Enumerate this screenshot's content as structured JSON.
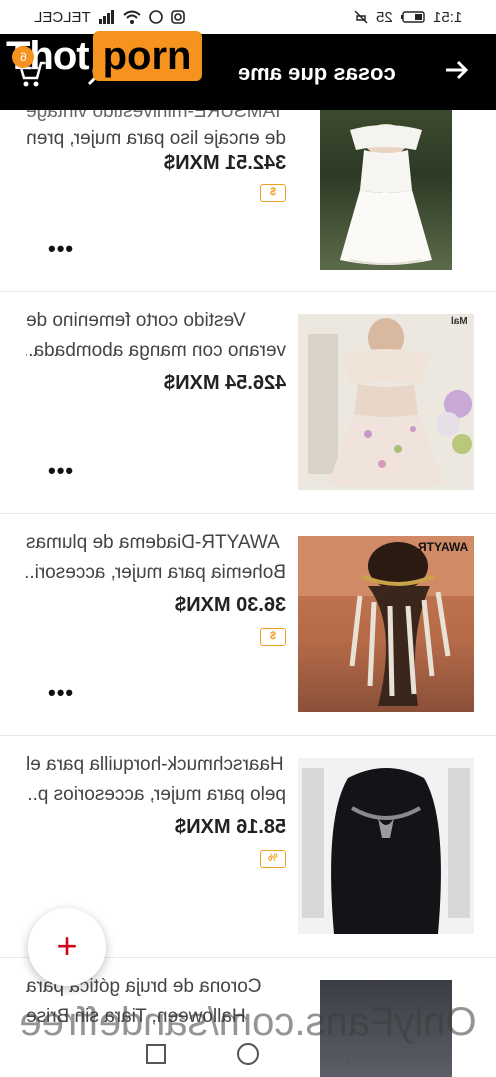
{
  "status": {
    "carrier": "TELCEL",
    "time": "1:51",
    "battery": "25"
  },
  "header": {
    "title": "cosas que ame",
    "logo_left": "Thot",
    "logo_right": "porn",
    "cart_count": "6"
  },
  "products": [
    {
      "title_lines": [
        "IAMSURE-minivestido vintage",
        "de encaje liso para mujer, pren..."
      ],
      "price": "342.51 MXN$",
      "tag": "$"
    },
    {
      "title_lines": [
        "Vestido corto femenino de",
        "verano con manga abombada..."
      ],
      "price": "426.54 MXN$",
      "tag": ""
    },
    {
      "title_lines": [
        "AWAYTR-Diadema de plumas",
        "Bohemia para mujer, accesori..."
      ],
      "price": "36.30 MXN$",
      "tag": "$"
    },
    {
      "title_lines": [
        "Haarschmuck-horquilla para el",
        "pelo para mujer, accesorios p..."
      ],
      "price": "58.16 MXN$",
      "tag": "%"
    },
    {
      "title_lines": [
        "Corona de bruja gótica para",
        "Halloween, Tiara sin Brise"
      ],
      "price": "",
      "tag": ""
    }
  ],
  "image_labels": {
    "p2": "Mal",
    "p3": "AWAYTR"
  },
  "fab_label": "+",
  "watermark": "OnlyFans.com/sandeffree",
  "colors": {
    "app_bar": "#000000",
    "accent": "#f6931e",
    "fab_icon": "#d0021b",
    "tag": "#f0a020"
  }
}
